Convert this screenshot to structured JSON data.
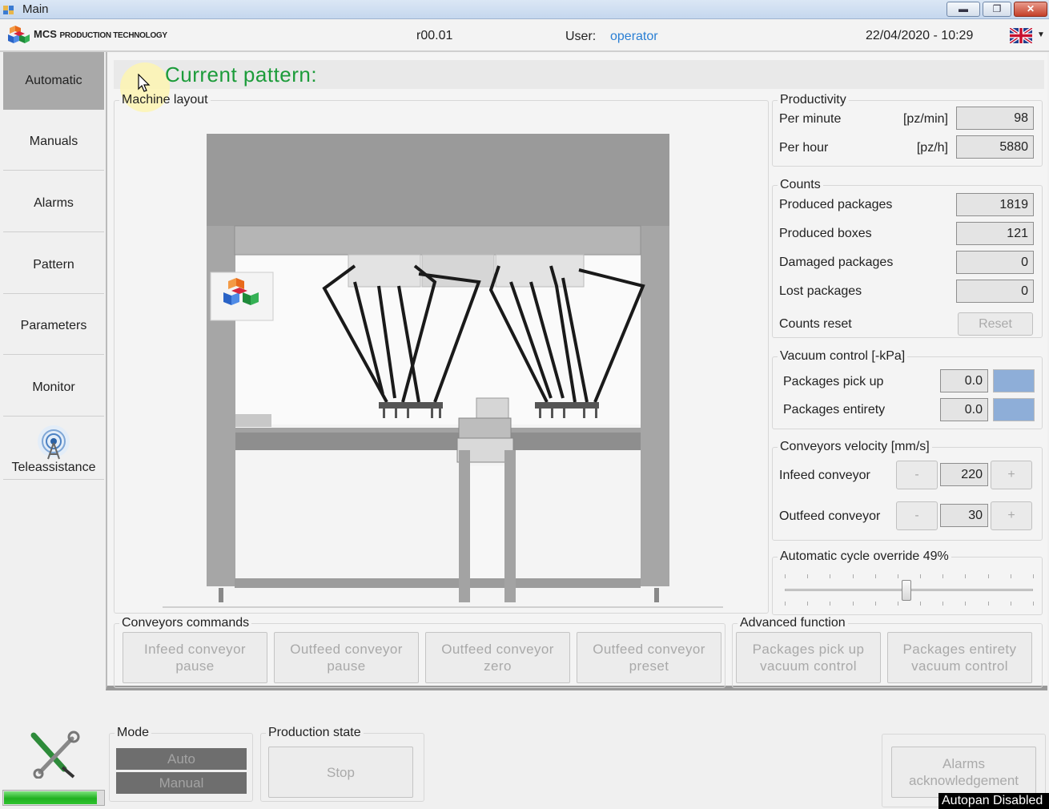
{
  "window": {
    "title": "Main",
    "minimize": "▬",
    "maximize": "❐",
    "close": "✕"
  },
  "header": {
    "logo_brand": "MCS",
    "logo_sub": "PRODUCTION TECHNOLOGY",
    "version": "r00.01",
    "user_label": "User:",
    "user_value": "operator",
    "datetime": "22/04/2020 - 10:29"
  },
  "sidebar": {
    "items": [
      {
        "label": "Automatic"
      },
      {
        "label": "Manuals"
      },
      {
        "label": "Alarms"
      },
      {
        "label": "Pattern"
      },
      {
        "label": "Parameters"
      },
      {
        "label": "Monitor"
      },
      {
        "label": "Teleassistance"
      }
    ]
  },
  "main": {
    "current_pattern_label": "Current pattern:",
    "machine_layout_label": "Machine layout"
  },
  "productivity": {
    "title": "Productivity",
    "rows": [
      {
        "label": "Per minute",
        "unit": "[pz/min]",
        "value": "98"
      },
      {
        "label": "Per hour",
        "unit": "[pz/h]",
        "value": "5880"
      }
    ]
  },
  "counts": {
    "title": "Counts",
    "rows": [
      {
        "label": "Produced packages",
        "value": "1819"
      },
      {
        "label": "Produced boxes",
        "value": "121"
      },
      {
        "label": "Damaged packages",
        "value": "0"
      },
      {
        "label": "Lost packages",
        "value": "0"
      }
    ],
    "reset_label": "Counts reset",
    "reset_button": "Reset"
  },
  "vacuum": {
    "title": "Vacuum control [-kPa]",
    "rows": [
      {
        "label": "Packages pick up",
        "value": "0.0"
      },
      {
        "label": "Packages entirety",
        "value": "0.0"
      }
    ],
    "indicator_color": "#8eaed8"
  },
  "conveyors_velocity": {
    "title": "Conveyors velocity [mm/s]",
    "rows": [
      {
        "label": "Infeed conveyor",
        "value": "220",
        "minus": "-",
        "plus": "+"
      },
      {
        "label": "Outfeed conveyor",
        "value": "30",
        "minus": "-",
        "plus": "+"
      }
    ]
  },
  "cycle_override": {
    "title": "Automatic cycle override  49%",
    "percent": 49
  },
  "conveyors_commands": {
    "title": "Conveyors commands",
    "buttons": [
      {
        "line1": "Infeed conveyor",
        "line2": "pause"
      },
      {
        "line1": "Outfeed conveyor",
        "line2": "pause"
      },
      {
        "line1": "Outfeed conveyor",
        "line2": "zero"
      },
      {
        "line1": "Outfeed conveyor",
        "line2": "preset"
      }
    ]
  },
  "advanced_function": {
    "title": "Advanced function",
    "buttons": [
      {
        "line1": "Packages pick up",
        "line2": "vacuum control"
      },
      {
        "line1": "Packages entirety",
        "line2": "vacuum control"
      }
    ]
  },
  "bottom": {
    "mode_title": "Mode",
    "mode_auto": "Auto",
    "mode_manual": "Manual",
    "production_title": "Production state",
    "stop_button": "Stop",
    "alarms_ack_line1": "Alarms",
    "alarms_ack_line2": "acknowledgement",
    "autopan_status": "Autopan Disabled",
    "progress_fraction": 0.92
  }
}
